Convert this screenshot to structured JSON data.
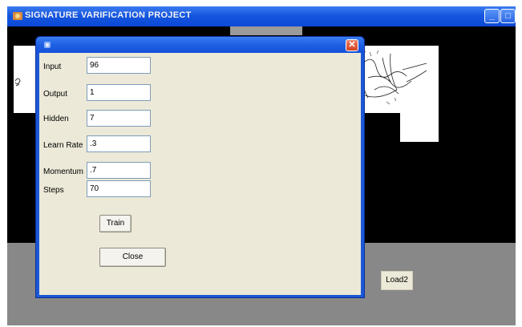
{
  "main_window": {
    "title": "SIGNATURE VARIFICATION PROJECT",
    "load2_label": "Load2",
    "controls": {
      "minimize": "_",
      "maximize": "□",
      "close": "x"
    }
  },
  "dialog": {
    "close_glyph": "✕",
    "fields": [
      {
        "label": "Input",
        "value": "96"
      },
      {
        "label": "Output",
        "value": "1"
      },
      {
        "label": "Hidden",
        "value": "7"
      },
      {
        "label": "Learn Rate",
        "value": ".3"
      },
      {
        "label": "Momentum",
        "value": ".7"
      },
      {
        "label": "Steps",
        "value": "70"
      }
    ],
    "train_label": "Train",
    "close_label": "Close"
  },
  "colors": {
    "titlebar": "#1556e0",
    "dialog_face": "#ece9d8",
    "desktop_grey": "#888888",
    "close_red": "#d4411e"
  },
  "icons": [
    "app-icon",
    "dialog-app-icon",
    "close-icon"
  ]
}
